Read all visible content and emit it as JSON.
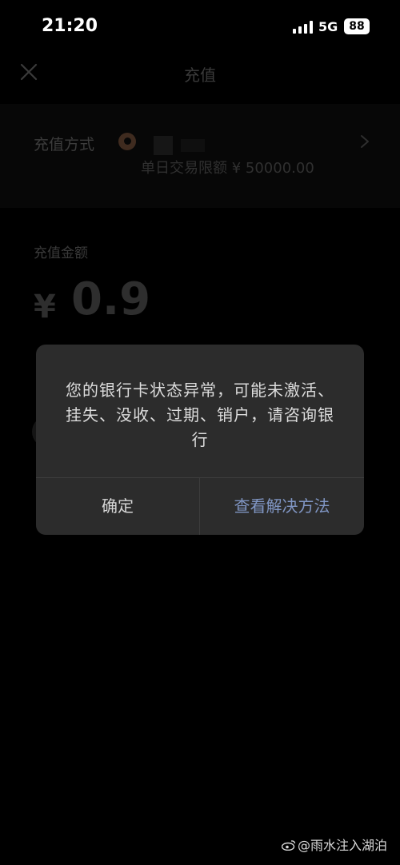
{
  "status_bar": {
    "time": "21:20",
    "network": "5G",
    "battery": "88"
  },
  "nav": {
    "title": "充值",
    "close_icon": "close-icon"
  },
  "payment_method": {
    "label": "充值方式",
    "bank_limit": "单日交易限额 ¥ 50000.00",
    "chevron_icon": "chevron-right-icon"
  },
  "amount": {
    "label": "充值金额",
    "currency": "¥",
    "value": "0.9"
  },
  "dialog": {
    "message": "您的银行卡状态异常，可能未激活、挂失、没收、过期、销户，请咨询银行",
    "confirm_label": "确定",
    "solution_label": "查看解决方法"
  },
  "watermark": {
    "text": "@雨水注入湖泊"
  },
  "colors": {
    "dialog_bg": "#2c2c2c",
    "link_blue": "#8096c4",
    "background": "#000000"
  }
}
